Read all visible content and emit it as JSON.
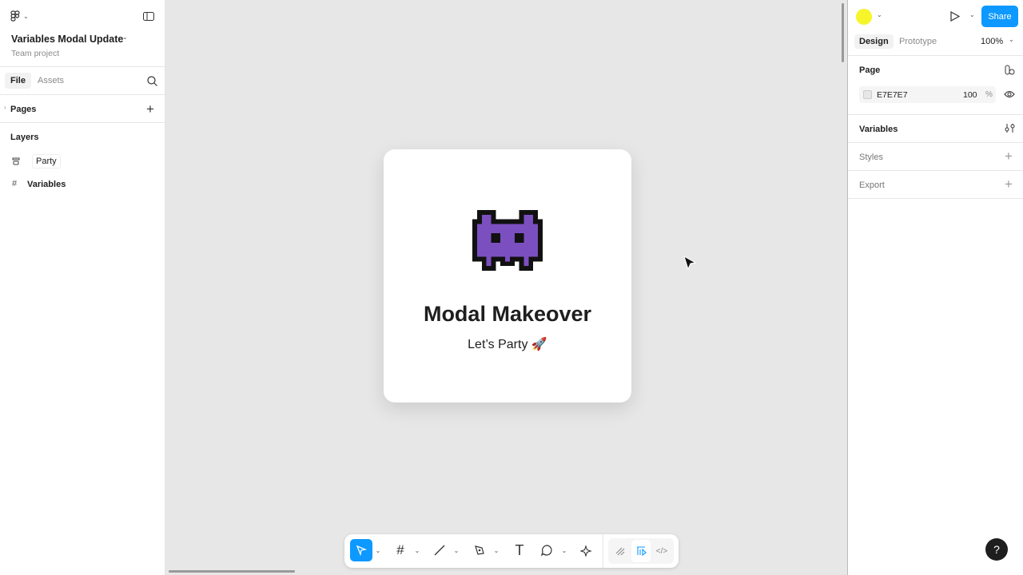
{
  "file": {
    "title": "Variables Modal Update",
    "subtitle": "Team project"
  },
  "left_tabs": {
    "file": "File",
    "assets": "Assets"
  },
  "pages_label": "Pages",
  "layers_label": "Layers",
  "layers": [
    {
      "name": "Party",
      "icon": "auto-layout-icon"
    },
    {
      "name": "Variables",
      "icon": "frame-icon"
    }
  ],
  "right": {
    "share": "Share",
    "tabs": {
      "design": "Design",
      "prototype": "Prototype"
    },
    "zoom": "100%",
    "page_label": "Page",
    "page_color": "E7E7E7",
    "page_opacity": "100",
    "percent": "%",
    "variables": "Variables",
    "styles": "Styles",
    "export": "Export"
  },
  "card": {
    "title": "Modal Makeover",
    "subtitle": "Let’s Party 🚀"
  },
  "help": "?",
  "colors": {
    "accent": "#0d99ff",
    "canvas": "#e7e7e7",
    "monster": "#7b4fc0"
  }
}
